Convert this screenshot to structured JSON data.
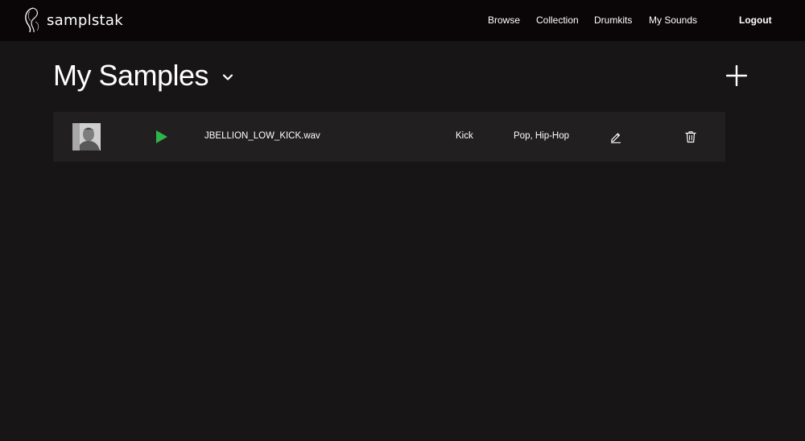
{
  "app": {
    "brand_name": "samplstak"
  },
  "nav": {
    "items": [
      {
        "label": "Browse"
      },
      {
        "label": "Collection"
      },
      {
        "label": "Drumkits"
      },
      {
        "label": "My Sounds"
      }
    ],
    "logout_label": "Logout"
  },
  "page": {
    "title": "My Samples",
    "title_icon": "chevron-down-icon",
    "add_icon": "plus-icon"
  },
  "samples": [
    {
      "file_name": "JBELLION_LOW_KICK.wav",
      "category": "Kick",
      "genres": "Pop, Hip-Hop",
      "play_icon": "play-icon",
      "edit_icon": "pencil-icon",
      "delete_icon": "trash-icon"
    }
  ],
  "colors": {
    "background": "#181516",
    "navbar": "#0a0607",
    "row": "#221f20",
    "play_accent": "#2fb44a",
    "text": "#ffffff"
  }
}
